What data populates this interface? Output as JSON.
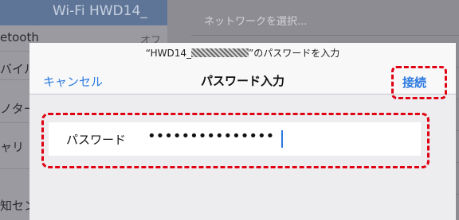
{
  "background": {
    "sidebar_top_text": "Wi-Fi HWD14_",
    "sidebar": [
      {
        "label": "etooth",
        "value": "オフ"
      },
      {
        "label": "バイル",
        "value": ""
      },
      {
        "label": "ノター",
        "value": ""
      },
      {
        "label": "ャリ",
        "value": ""
      },
      {
        "label": "知セン",
        "value": ""
      }
    ],
    "network_select": "ネットワークを選択..."
  },
  "dialog": {
    "subtitle_prefix": "“HWD14_",
    "subtitle_suffix": "”のパスワードを入力",
    "title": "パスワード入力",
    "cancel": "キャンセル",
    "connect": "接続",
    "password_label": "パスワード",
    "password_value": "•••••••••••••••"
  },
  "colors": {
    "accent": "#2c7ae0",
    "highlight": "#e00012"
  }
}
